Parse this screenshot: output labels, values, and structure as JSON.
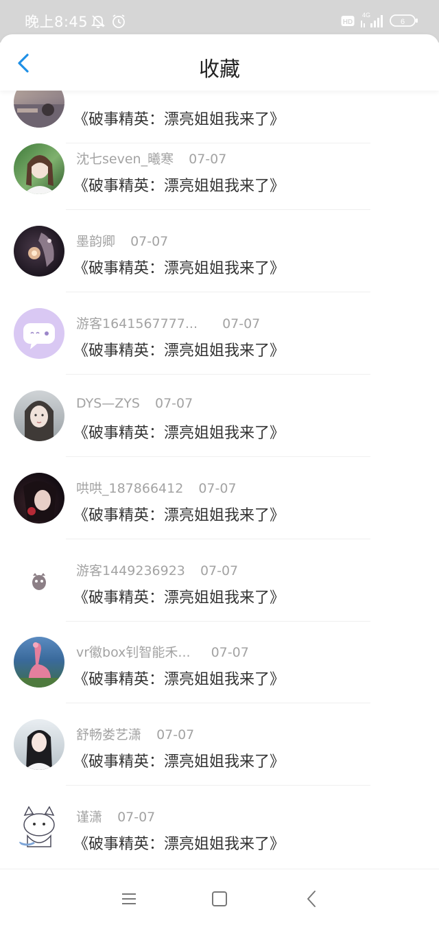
{
  "status_bar": {
    "time": "晚上8:45",
    "network": "4G",
    "battery": "6",
    "hd_label": "HD"
  },
  "header": {
    "title": "收藏",
    "back_icon": "chevron-left-icon",
    "accent_color": "#1e8fe6"
  },
  "items": [
    {
      "name": "",
      "date": "",
      "title": "《破事精英：漂亮姐姐我来了》"
    },
    {
      "name": "沈七seven_曦寒",
      "date": "07-07",
      "title": "《破事精英：漂亮姐姐我来了》"
    },
    {
      "name": "墨韵卿",
      "date": "07-07",
      "title": "《破事精英：漂亮姐姐我来了》"
    },
    {
      "name": "游客1641567777...",
      "date": "07-07",
      "title": "《破事精英：漂亮姐姐我来了》"
    },
    {
      "name": "DYS—ZYS",
      "date": "07-07",
      "title": "《破事精英：漂亮姐姐我来了》"
    },
    {
      "name": "哄哄_187866412",
      "date": "07-07",
      "title": "《破事精英：漂亮姐姐我来了》"
    },
    {
      "name": "游客1449236923",
      "date": "07-07",
      "title": "《破事精英：漂亮姐姐我来了》"
    },
    {
      "name": "vr徽box钊智能禾...",
      "date": "07-07",
      "title": "《破事精英：漂亮姐姐我来了》"
    },
    {
      "name": "舒畅娄艺潇",
      "date": "07-07",
      "title": "《破事精英：漂亮姐姐我来了》"
    },
    {
      "name": "谨潇",
      "date": "07-07",
      "title": "《破事精英：漂亮姐姐我来了》"
    }
  ],
  "nav": {
    "menu_icon": "menu-icon",
    "home_icon": "square-home-icon",
    "back_icon": "back-triangle-icon"
  }
}
